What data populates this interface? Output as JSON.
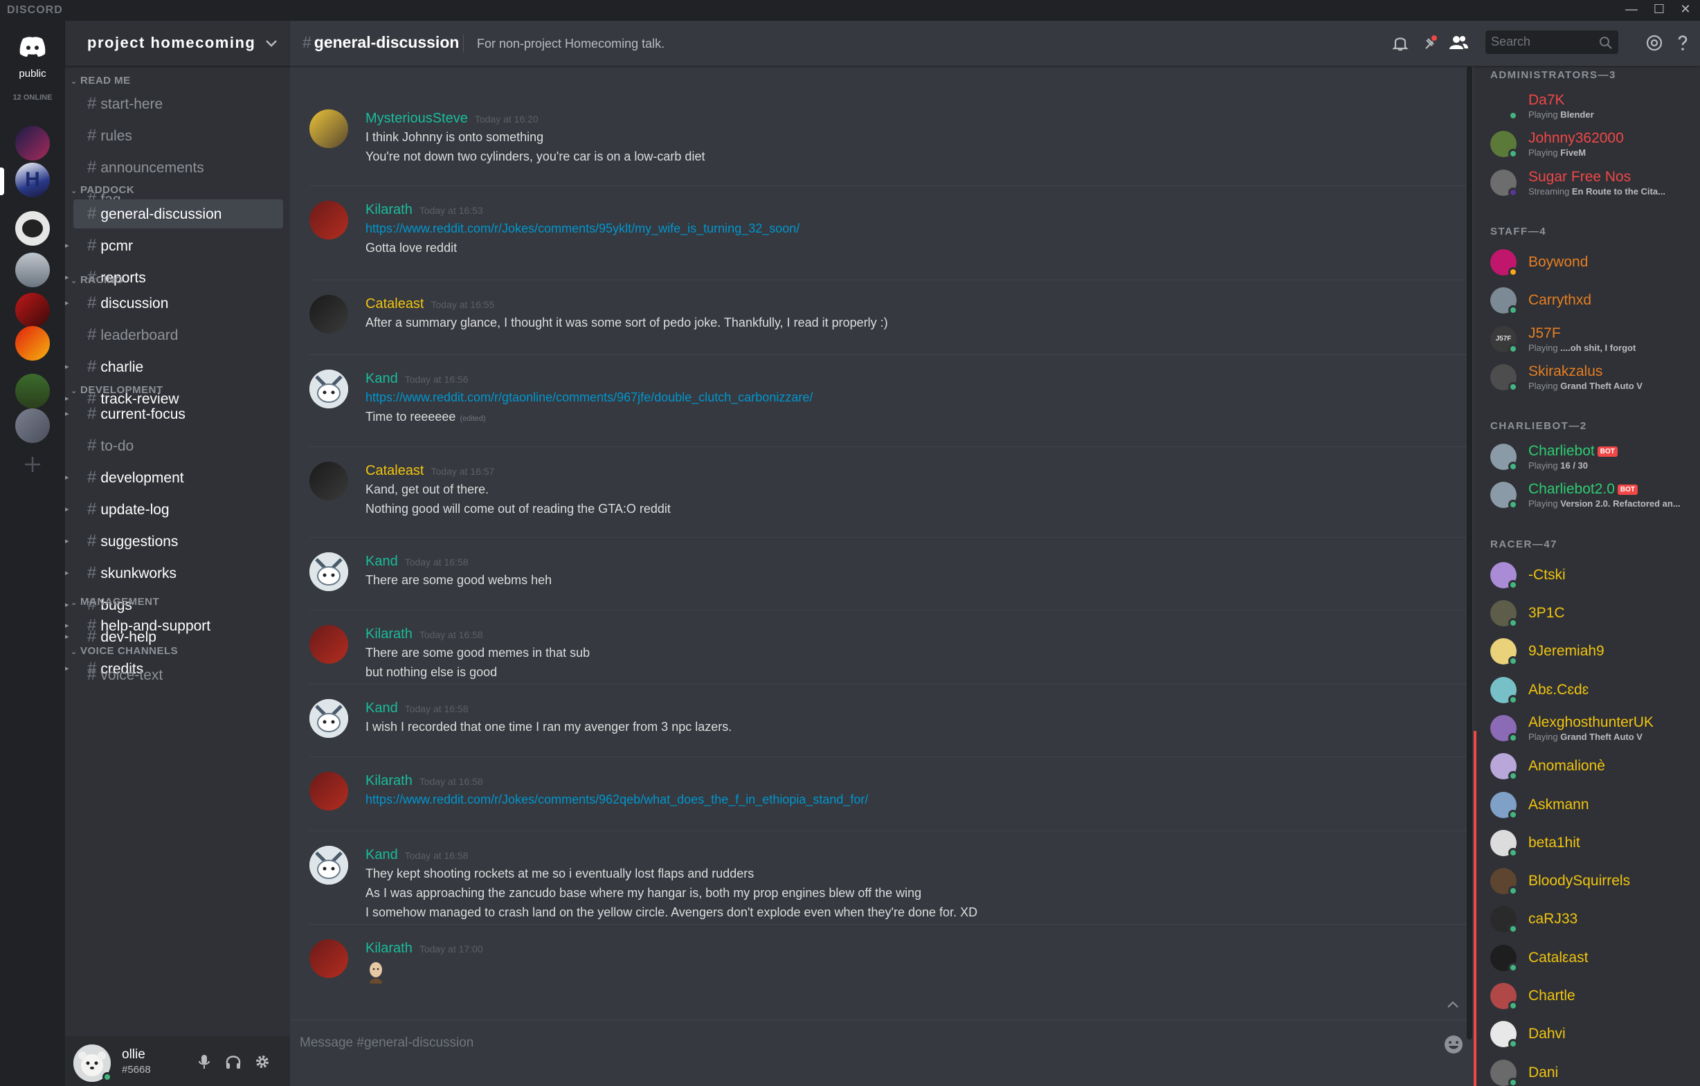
{
  "app": {
    "brand": "DISCORD"
  },
  "window": {
    "minimize": "—",
    "maximize": "☐",
    "close": "✕"
  },
  "rail": {
    "home_label": "public",
    "online": "12 ONLINE"
  },
  "server": {
    "name": "project homecoming"
  },
  "categories": [
    {
      "name": "READ ME",
      "channels": [
        {
          "name": "start-here",
          "state": "normal"
        },
        {
          "name": "rules",
          "state": "normal"
        },
        {
          "name": "announcements",
          "state": "normal"
        },
        {
          "name": "faq",
          "state": "normal"
        }
      ]
    },
    {
      "name": "PADDOCK",
      "channels": [
        {
          "name": "general-discussion",
          "state": "active"
        },
        {
          "name": "pcmr",
          "state": "unread"
        },
        {
          "name": "reports",
          "state": "unread"
        }
      ]
    },
    {
      "name": "RACING",
      "channels": [
        {
          "name": "discussion",
          "state": "unread"
        },
        {
          "name": "leaderboard",
          "state": "normal"
        },
        {
          "name": "charlie",
          "state": "unread"
        },
        {
          "name": "track-review",
          "state": "unread"
        }
      ]
    },
    {
      "name": "DEVELOPMENT",
      "channels": [
        {
          "name": "current-focus",
          "state": "unread"
        },
        {
          "name": "to-do",
          "state": "normal"
        },
        {
          "name": "development",
          "state": "unread"
        },
        {
          "name": "update-log",
          "state": "unread"
        },
        {
          "name": "suggestions",
          "state": "unread"
        },
        {
          "name": "skunkworks",
          "state": "unread"
        },
        {
          "name": "bugs",
          "state": "unread"
        },
        {
          "name": "dev-help",
          "state": "unread"
        },
        {
          "name": "credits",
          "state": "unread"
        }
      ]
    },
    {
      "name": "MANAGEMENT",
      "channels": [
        {
          "name": "help-and-support",
          "state": "unread"
        }
      ]
    },
    {
      "name": "VOICE CHANNELS",
      "channels": [
        {
          "name": "voice-text",
          "state": "normal"
        }
      ]
    }
  ],
  "user": {
    "name": "ollie",
    "tag": "#5668"
  },
  "channel": {
    "name": "general-discussion",
    "topic": "For non-project Homecoming talk."
  },
  "search": {
    "placeholder": "Search"
  },
  "composer": {
    "placeholder": "Message #general-discussion"
  },
  "messages": [
    {
      "author": "MysteriousSteve",
      "color": "#1abc9c",
      "time": "Today at 16:20",
      "avatar": "steve",
      "lines": [
        {
          "text": "I think Johnny is onto something"
        },
        {
          "text": "You're not down two cylinders, you're car is on a low-carb diet"
        }
      ]
    },
    {
      "author": "Kilarath",
      "color": "#1abc9c",
      "time": "Today at 16:53",
      "avatar": "kilarath",
      "lines": [
        {
          "text": "https://www.reddit.com/r/Jokes/comments/95yklt/my_wife_is_turning_32_soon/",
          "link": true
        },
        {
          "text": "Gotta love reddit"
        }
      ]
    },
    {
      "author": "Cataleast",
      "color": "#f1c40f",
      "time": "Today at 16:55",
      "avatar": "cataleast",
      "lines": [
        {
          "text": "After a summary glance, I thought it was some sort of pedo joke. Thankfully, I read it properly :)"
        }
      ]
    },
    {
      "author": "Kand",
      "color": "#1abc9c",
      "time": "Today at 16:56",
      "avatar": "kand",
      "lines": [
        {
          "text": "https://www.reddit.com/r/gtaonline/comments/967jfe/double_clutch_carbonizzare/",
          "link": true
        },
        {
          "text": "Time to reeeeee",
          "edited": "(edited)"
        }
      ]
    },
    {
      "author": "Cataleast",
      "color": "#f1c40f",
      "time": "Today at 16:57",
      "avatar": "cataleast",
      "lines": [
        {
          "text": "Kand, get out of there."
        },
        {
          "text": "Nothing good will come out of reading the GTA:O reddit"
        }
      ]
    },
    {
      "author": "Kand",
      "color": "#1abc9c",
      "time": "Today at 16:58",
      "avatar": "kand",
      "lines": [
        {
          "text": "There are some good webms heh"
        }
      ]
    },
    {
      "author": "Kilarath",
      "color": "#1abc9c",
      "time": "Today at 16:58",
      "avatar": "kilarath",
      "lines": [
        {
          "text": "There are some good memes in that sub"
        },
        {
          "text": "but nothing else is good"
        }
      ]
    },
    {
      "author": "Kand",
      "color": "#1abc9c",
      "time": "Today at 16:58",
      "avatar": "kand",
      "lines": [
        {
          "text": "I wish I recorded that one time I ran my avenger from 3 npc lazers."
        }
      ]
    },
    {
      "author": "Kilarath",
      "color": "#1abc9c",
      "time": "Today at 16:58",
      "avatar": "kilarath",
      "lines": [
        {
          "text": "https://www.reddit.com/r/Jokes/comments/962qeb/what_does_the_f_in_ethiopia_stand_for/",
          "link": true
        }
      ]
    },
    {
      "author": "Kand",
      "color": "#1abc9c",
      "time": "Today at 16:58",
      "avatar": "kand",
      "lines": [
        {
          "text": "They kept shooting rockets at me so i eventually lost flaps and rudders"
        },
        {
          "text": "As I was approaching the zancudo base where my hangar is, both my prop engines blew off the wing"
        },
        {
          "text": "I somehow managed to crash land on the yellow circle. Avengers don't explode even when they're done for. XD"
        }
      ]
    },
    {
      "author": "Kilarath",
      "color": "#1abc9c",
      "time": "Today at 17:00",
      "avatar": "kilarath",
      "lines": [],
      "emoji": "bald-head-emoji"
    }
  ],
  "member_groups": [
    {
      "header": "ADMINISTRATORS—3",
      "members": [
        {
          "name": "Da7K",
          "color": "#f04747",
          "status": "#43b581",
          "activity_prefix": "Playing",
          "activity": "Blender",
          "avatar": "#2f3136"
        },
        {
          "name": "Johnny362000",
          "color": "#f04747",
          "status": "#43b581",
          "activity_prefix": "Playing",
          "activity": "FiveM",
          "avatar": "#5b7a3a"
        },
        {
          "name": "Sugar Free Nos",
          "color": "#f04747",
          "status": "#593695",
          "activity_prefix": "Streaming",
          "activity": "En Route to the Cita...",
          "avatar": "#6d6d6d"
        }
      ]
    },
    {
      "header": "STAFF—4",
      "members": [
        {
          "name": "Boywond",
          "color": "#e67e22",
          "status": "#faa61a",
          "activity": "",
          "avatar": "#c0176c"
        },
        {
          "name": "Carrythxd",
          "color": "#e67e22",
          "status": "#43b581",
          "activity": "",
          "avatar": "#7c8a96"
        },
        {
          "name": "J57F",
          "color": "#e67e22",
          "status": "#43b581",
          "activity_prefix": "Playing",
          "activity": "....oh shit, I forgot",
          "avatar": "#3a3a3a",
          "avatar_text": "J57F"
        },
        {
          "name": "Skirakzalus",
          "color": "#e67e22",
          "status": "#43b581",
          "activity_prefix": "Playing",
          "activity": "Grand Theft Auto V",
          "avatar": "#4d4d4d"
        }
      ]
    },
    {
      "header": "CHARLIEBOT—2",
      "members": [
        {
          "name": "Charliebot",
          "color": "#2ecc71",
          "status": "#43b581",
          "bot": "BOT",
          "activity_prefix": "Playing",
          "activity": "16 / 30",
          "avatar": "#8a9aa6"
        },
        {
          "name": "Charliebot2.0",
          "color": "#2ecc71",
          "status": "#43b581",
          "bot": "BOT",
          "activity_prefix": "Playing",
          "activity": "Version 2.0. Refactored an...",
          "avatar": "#8a9aa6"
        }
      ]
    },
    {
      "header": "RACER—47",
      "members": [
        {
          "name": "-Ctski",
          "color": "#f1c40f",
          "status": "#43b581",
          "activity": "",
          "avatar": "#a98bd6"
        },
        {
          "name": "3P1C",
          "color": "#f1c40f",
          "status": "#43b581",
          "activity": "",
          "avatar": "#5d5d4a"
        },
        {
          "name": "9Jeremiah9",
          "color": "#f1c40f",
          "status": "#43b581",
          "activity": "",
          "avatar": "#e9d27a"
        },
        {
          "name": "Abɛ.Cɛdɛ",
          "color": "#f1c40f",
          "status": "#43b581",
          "activity": "",
          "avatar": "#78c0c8"
        },
        {
          "name": "AlexghosthunterUK",
          "color": "#f1c40f",
          "status": "#43b581",
          "activity_prefix": "Playing",
          "activity": "Grand Theft Auto V",
          "avatar": "#8b6bb5"
        },
        {
          "name": "Anomalionè",
          "color": "#f1c40f",
          "status": "#43b581",
          "activity": "",
          "avatar": "#b8a7d8"
        },
        {
          "name": "Askmann",
          "color": "#f1c40f",
          "status": "#43b581",
          "activity": "",
          "avatar": "#7fa0c7"
        },
        {
          "name": "beta1hit",
          "color": "#f1c40f",
          "status": "#43b581",
          "activity": "",
          "avatar": "#dcdcdc"
        },
        {
          "name": "BloodySquirrels",
          "color": "#f1c40f",
          "status": "#43b581",
          "activity": "",
          "avatar": "#5e4530"
        },
        {
          "name": "caRJ33",
          "color": "#f1c40f",
          "status": "#43b581",
          "activity": "",
          "avatar": "#2a2a2a"
        },
        {
          "name": "Catalεast",
          "color": "#f1c40f",
          "status": "#43b581",
          "activity": "",
          "avatar": "#1e1e1e"
        },
        {
          "name": "Chartle",
          "color": "#f1c40f",
          "status": "#43b581",
          "activity": "",
          "avatar": "#b04848"
        },
        {
          "name": "Dahvi",
          "color": "#f1c40f",
          "status": "#43b581",
          "activity": "",
          "avatar": "#e8e8e8"
        },
        {
          "name": "Dani",
          "color": "#f1c40f",
          "status": "#43b581",
          "activity": "",
          "avatar": "#6a6a6a"
        }
      ]
    }
  ],
  "colors": {
    "link": "#0096cf",
    "accent": "#7289da",
    "online": "#43b581",
    "idle": "#faa61a",
    "dnd": "#f04747"
  }
}
